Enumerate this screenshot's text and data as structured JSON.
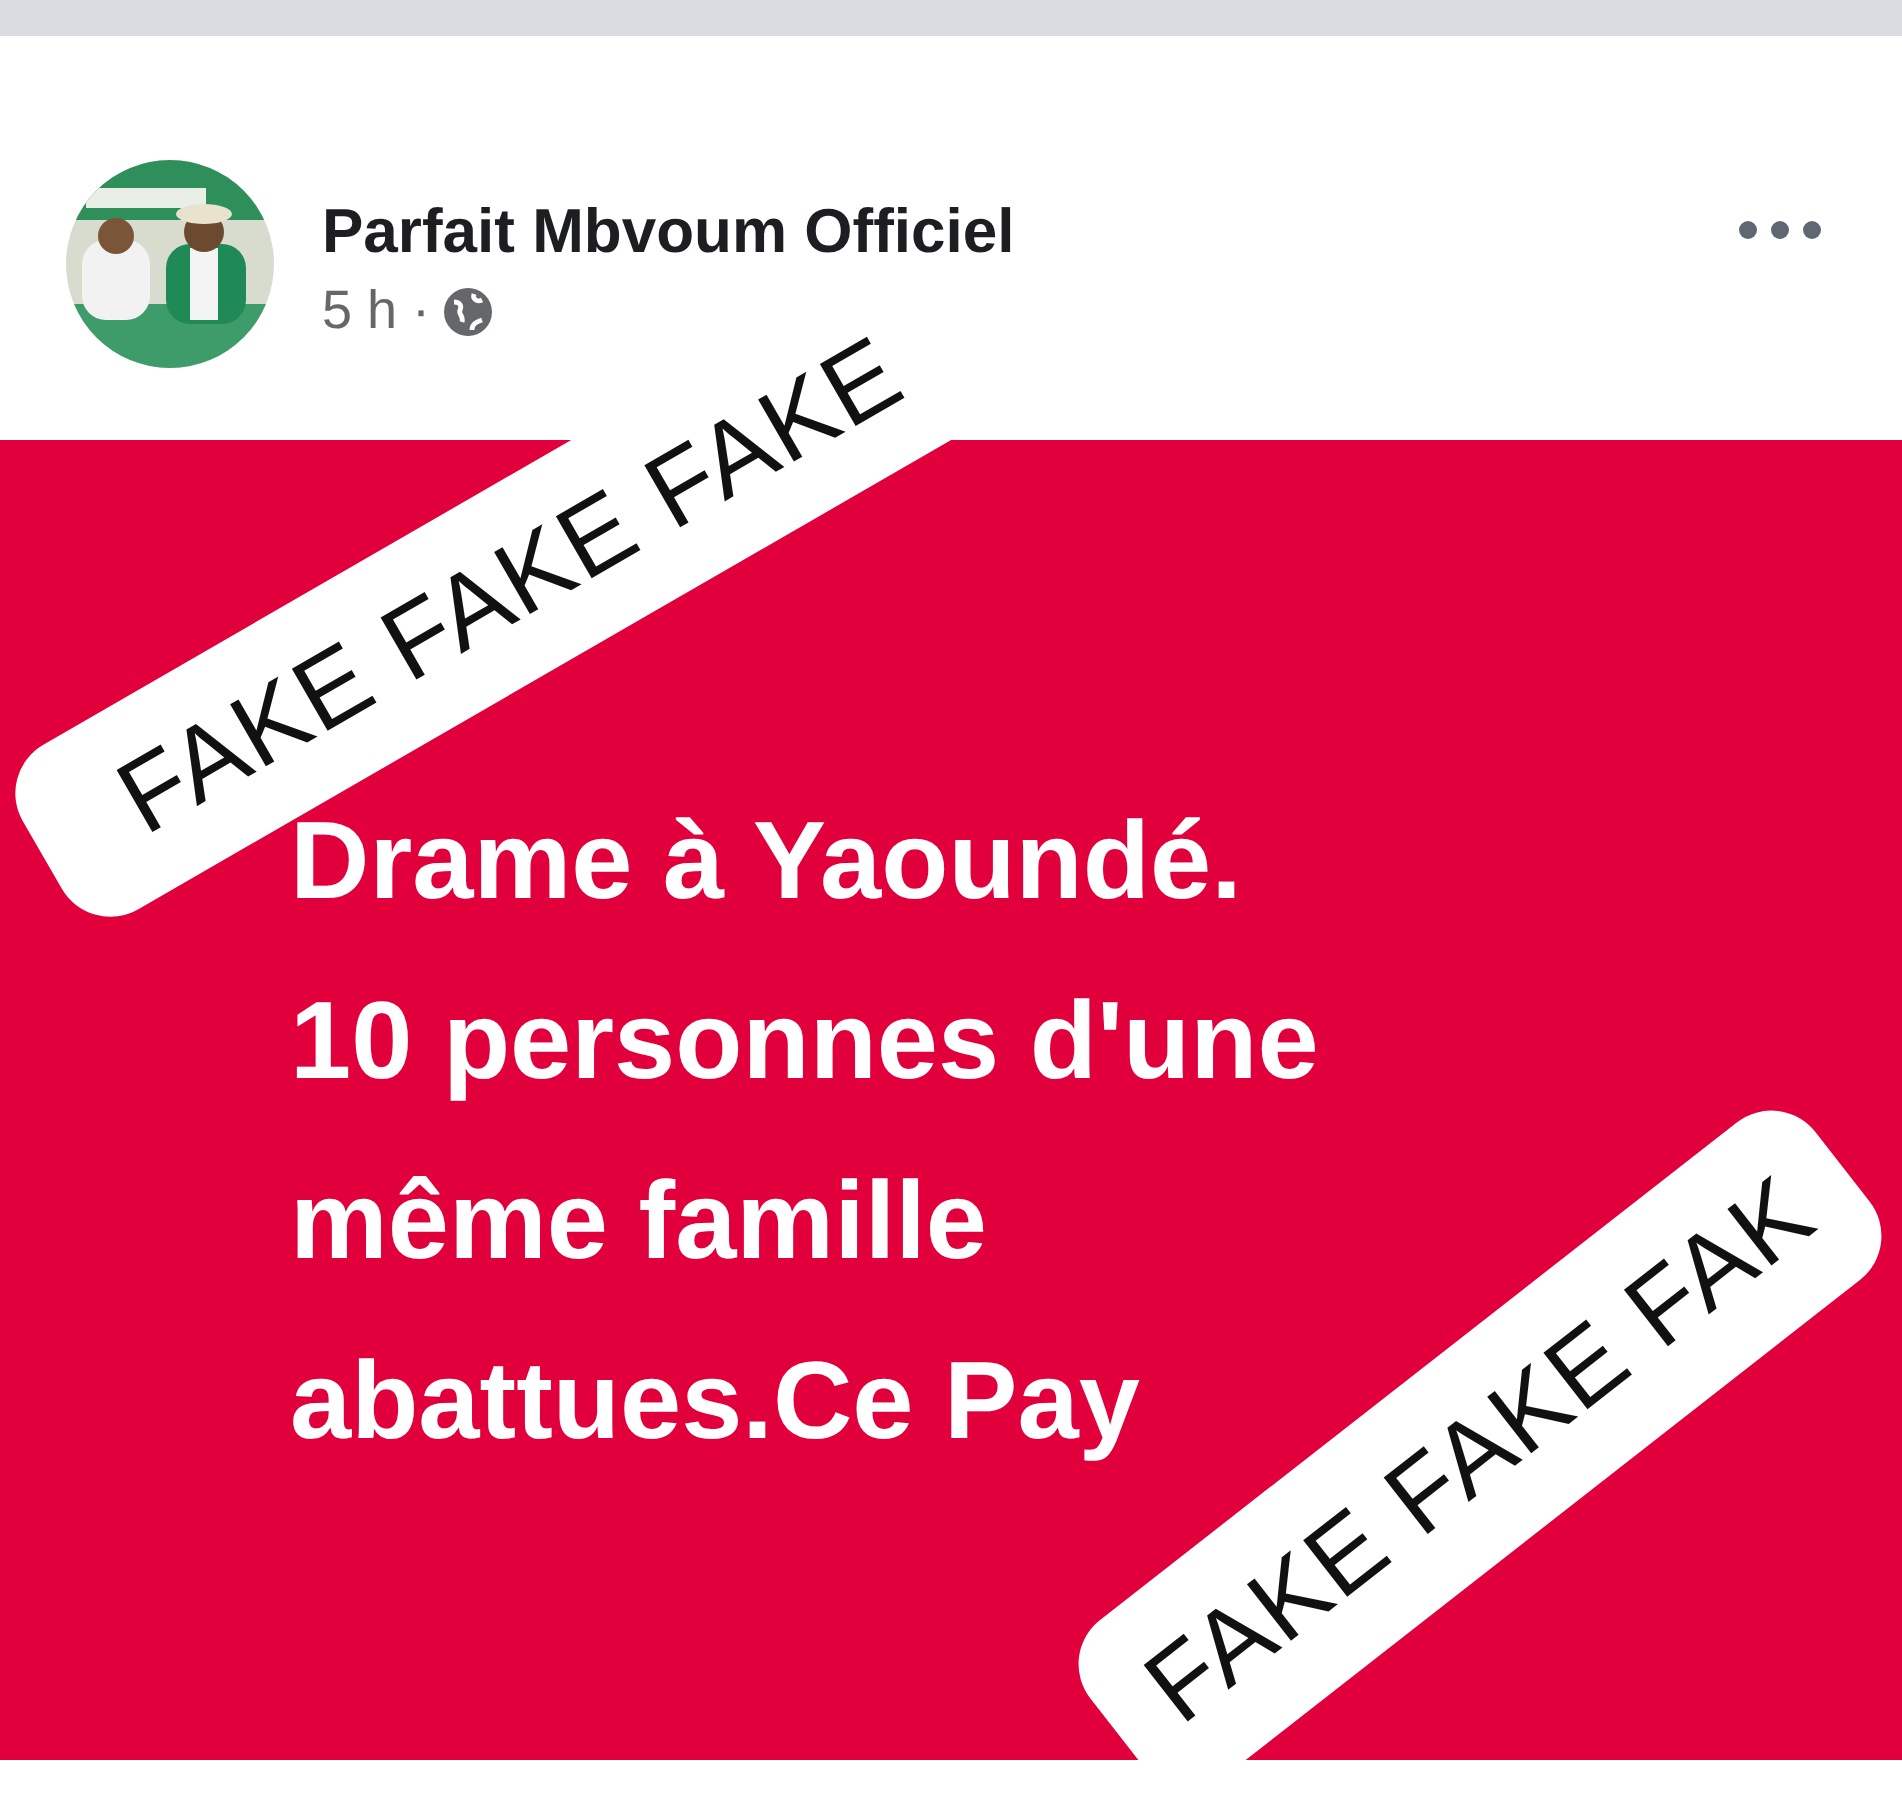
{
  "post": {
    "author": "Parfait Mbvoum Officiel",
    "time": "5 h ·"
  },
  "content": {
    "lines": [
      "Drame à Yaoundé.",
      "10 personnes d'une",
      "même famille",
      "abattues.Ce Pay"
    ]
  },
  "stamps": [
    {
      "text": "FAKE FAKE FAKE"
    },
    {
      "text": "FAKE FAKE FAK"
    }
  ]
}
